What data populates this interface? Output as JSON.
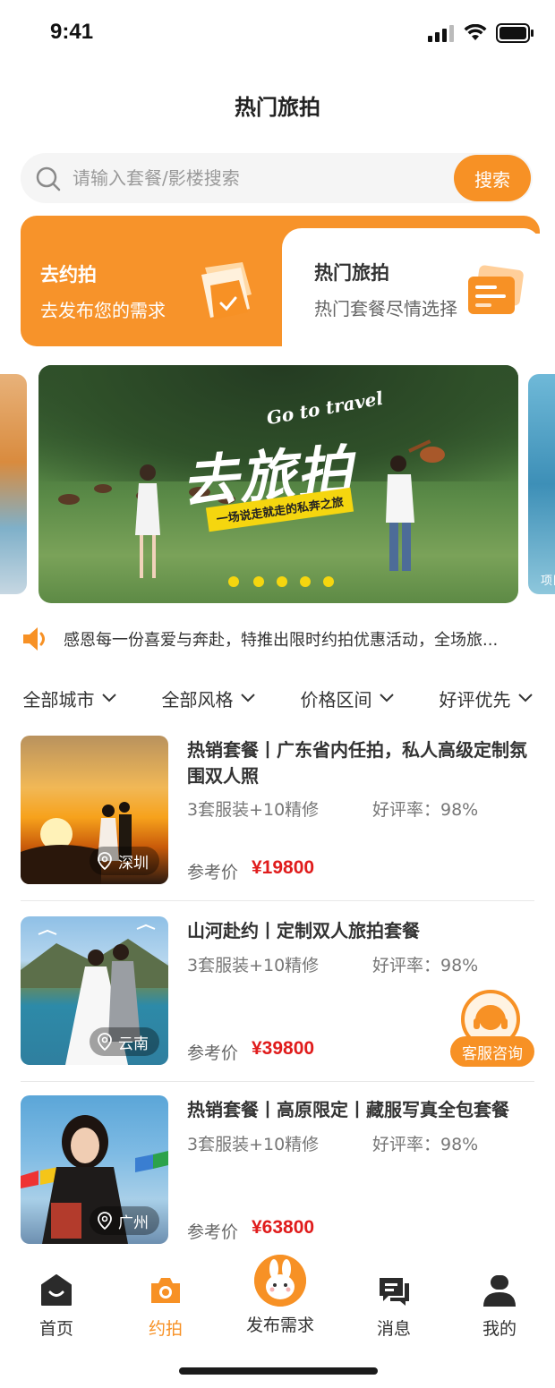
{
  "status_bar": {
    "time": "9:41"
  },
  "header": {
    "title": "热门旅拍"
  },
  "search": {
    "placeholder": "请输入套餐/影楼搜索",
    "button_label": "搜索"
  },
  "entries": [
    {
      "title": "去约拍",
      "subtitle": "去发布您的需求"
    },
    {
      "title": "热门旅拍",
      "subtitle": "热门套餐尽情选择"
    }
  ],
  "banner": {
    "headline": "去旅拍",
    "english": "Go to travel",
    "tagline": "一场说走就走的私奔之旅",
    "side_right_text": "项目"
  },
  "notice": {
    "text": "感恩每一份喜爱与奔赴，特推出限时约拍优惠活动，全场旅..."
  },
  "filters": [
    {
      "label": "全部城市"
    },
    {
      "label": "全部风格"
    },
    {
      "label": "价格区间"
    },
    {
      "label": "好评优先"
    }
  ],
  "products": [
    {
      "title": "热销套餐丨广东省内任拍，私人高级定制氛围双人照",
      "spec": "3套服装+10精修",
      "rating": "好评率：98%",
      "price_label": "参考价",
      "price": "¥19800",
      "location": "深圳"
    },
    {
      "title": "山河赴约丨定制双人旅拍套餐",
      "spec": "3套服装+10精修",
      "rating": "好评率：98%",
      "price_label": "参考价",
      "price": "¥39800",
      "location": "云南"
    },
    {
      "title": "热销套餐丨高原限定丨藏服写真全包套餐",
      "spec": "3套服装+10精修",
      "rating": "好评率：98%",
      "price_label": "参考价",
      "price": "¥63800",
      "location": "广州"
    }
  ],
  "customer_service": {
    "label": "客服咨询"
  },
  "tabs": [
    {
      "label": "首页",
      "icon": "home-icon"
    },
    {
      "label": "约拍",
      "icon": "camera-icon",
      "active": true
    },
    {
      "label": "发布需求",
      "icon": "bunny-avatar-icon"
    },
    {
      "label": "消息",
      "icon": "message-icon"
    },
    {
      "label": "我的",
      "icon": "profile-icon"
    }
  ],
  "colors": {
    "accent": "#f79125",
    "price": "#e01c1c"
  }
}
